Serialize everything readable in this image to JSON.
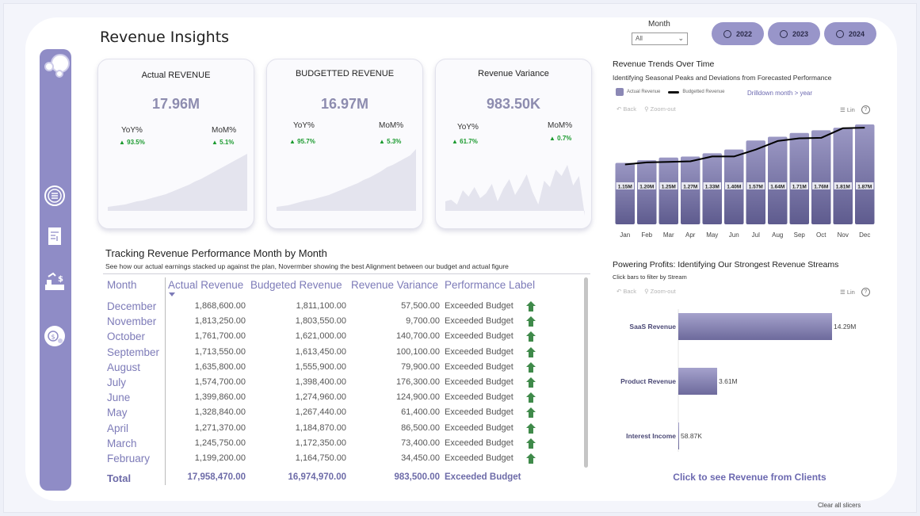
{
  "page_title": "Revenue Insights",
  "slicer": {
    "label": "Month",
    "value": "All",
    "years": [
      "2022",
      "2023",
      "2024"
    ]
  },
  "kpis": [
    {
      "title": "Actual REVENUE",
      "value": "17.96M",
      "yoy_label": "YoY%",
      "yoy": "93.5%",
      "mom_label": "MoM%",
      "mom": "5.1%",
      "spark": [
        5,
        6,
        7,
        8,
        10,
        12,
        13,
        15,
        17,
        19,
        21,
        24,
        27,
        30,
        33,
        37,
        40,
        44,
        48,
        52,
        56,
        60,
        64,
        68,
        72
      ]
    },
    {
      "title": "BUDGETTED REVENUE",
      "value": "16.97M",
      "yoy_label": "YoY%",
      "yoy": "95.7%",
      "mom_label": "MoM%",
      "mom": "5.3%",
      "spark": [
        5,
        6,
        7,
        9,
        11,
        13,
        14,
        16,
        18,
        20,
        23,
        26,
        29,
        32,
        35,
        39,
        42,
        46,
        50,
        55,
        58,
        62,
        66,
        70,
        78
      ]
    },
    {
      "title": "Revenue Variance",
      "value": "983.50K",
      "yoy_label": "YoY%",
      "yoy": "61.7%",
      "mom_label": "MoM%",
      "mom": "0.7%",
      "spark": [
        12,
        14,
        8,
        26,
        18,
        30,
        16,
        22,
        34,
        12,
        28,
        40,
        20,
        32,
        46,
        24,
        8,
        38,
        30,
        52,
        44,
        58,
        32,
        44,
        -6
      ]
    }
  ],
  "table": {
    "title": "Tracking Revenue Performance Month by Month",
    "subtitle": "See how our actual earnings stacked up against the plan, Novermber showing the best Alignment between our budget and actual figure",
    "headers": [
      "Month",
      "Actual Revenue",
      "Budgeted Revenue",
      "Revenue Variance",
      "Performance Label"
    ],
    "rows": [
      {
        "month": "December",
        "actual": "1,868,600.00",
        "budget": "1,811,100.00",
        "variance": "57,500.00",
        "label": "Exceeded Budget"
      },
      {
        "month": "November",
        "actual": "1,813,250.00",
        "budget": "1,803,550.00",
        "variance": "9,700.00",
        "label": "Exceeded Budget"
      },
      {
        "month": "October",
        "actual": "1,761,700.00",
        "budget": "1,621,000.00",
        "variance": "140,700.00",
        "label": "Exceeded Budget"
      },
      {
        "month": "September",
        "actual": "1,713,550.00",
        "budget": "1,613,450.00",
        "variance": "100,100.00",
        "label": "Exceeded Budget"
      },
      {
        "month": "August",
        "actual": "1,635,800.00",
        "budget": "1,555,900.00",
        "variance": "79,900.00",
        "label": "Exceeded Budget"
      },
      {
        "month": "July",
        "actual": "1,574,700.00",
        "budget": "1,398,400.00",
        "variance": "176,300.00",
        "label": "Exceeded Budget"
      },
      {
        "month": "June",
        "actual": "1,399,860.00",
        "budget": "1,274,960.00",
        "variance": "124,900.00",
        "label": "Exceeded Budget"
      },
      {
        "month": "May",
        "actual": "1,328,840.00",
        "budget": "1,267,440.00",
        "variance": "61,400.00",
        "label": "Exceeded Budget"
      },
      {
        "month": "April",
        "actual": "1,271,370.00",
        "budget": "1,184,870.00",
        "variance": "86,500.00",
        "label": "Exceeded Budget"
      },
      {
        "month": "March",
        "actual": "1,245,750.00",
        "budget": "1,172,350.00",
        "variance": "73,400.00",
        "label": "Exceeded Budget"
      },
      {
        "month": "February",
        "actual": "1,199,200.00",
        "budget": "1,164,750.00",
        "variance": "34,450.00",
        "label": "Exceeded Budget"
      }
    ],
    "total": {
      "month": "Total",
      "actual": "17,958,470.00",
      "budget": "16,974,970.00",
      "variance": "983,500.00",
      "label": "Exceeded Budget"
    }
  },
  "trend": {
    "title": "Revenue Trends Over Time",
    "subtitle": "Identifying Seasonal Peaks and Deviations from Forecasted Performance",
    "legend_actual": "Actual Revenue",
    "legend_budget": "Budgetted Revenue",
    "drill": "Drilldown month > year",
    "back": "Back",
    "zoom": "Zoom-out",
    "lin": "Lin",
    "help": "?"
  },
  "streams": {
    "title": "Powering Profits: Identifying Our Strongest Revenue Streams",
    "subtitle": "Click bars to filter by Stream",
    "back": "Back",
    "zoom": "Zoom-out",
    "lin": "Lin",
    "help": "?"
  },
  "clients_link": "Click to see Revenue from Clients",
  "clear_slicers": "Clear all slicers",
  "colors": {
    "accent": "#8f8cc6",
    "bar": "#8b88b5",
    "positive": "#1a9a2e",
    "link": "#6c69b0"
  },
  "chart_data": [
    {
      "type": "bar",
      "categories": [
        "Jan",
        "Feb",
        "Mar",
        "Apr",
        "May",
        "Jun",
        "Jul",
        "Aug",
        "Sep",
        "Oct",
        "Nov",
        "Dec"
      ],
      "series": [
        {
          "name": "Actual Revenue",
          "values": [
            1.15,
            1.2,
            1.25,
            1.27,
            1.33,
            1.4,
            1.57,
            1.64,
            1.71,
            1.76,
            1.81,
            1.87
          ]
        },
        {
          "name": "Budgetted Revenue",
          "values": [
            1.12,
            1.16,
            1.17,
            1.18,
            1.27,
            1.27,
            1.4,
            1.56,
            1.61,
            1.62,
            1.8,
            1.81
          ]
        }
      ],
      "data_labels": [
        "1.15M",
        "1.20M",
        "1.25M",
        "1.27M",
        "1.33M",
        "1.40M",
        "1.57M",
        "1.64M",
        "1.71M",
        "1.76M",
        "1.81M",
        "1.87M"
      ],
      "ylim": [
        0,
        1.9
      ]
    },
    {
      "type": "bar",
      "orientation": "horizontal",
      "categories": [
        "SaaS Revenue",
        "Product Revenue",
        "Interest Income"
      ],
      "values": [
        14.29,
        3.61,
        0.05887
      ],
      "data_labels": [
        "14.29M",
        "3.61M",
        "58.87K"
      ]
    }
  ]
}
